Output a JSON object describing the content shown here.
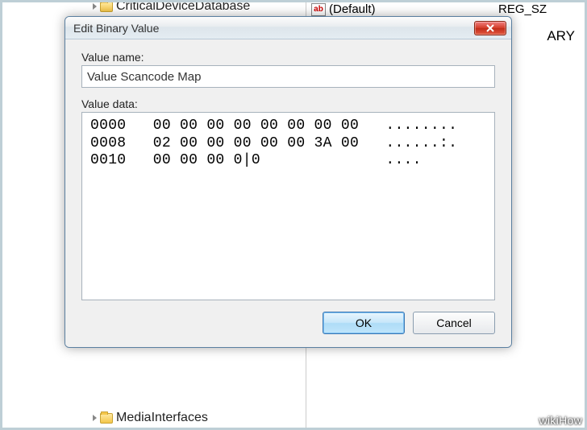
{
  "background": {
    "tree": {
      "item_top": "CriticalDeviceDatabase",
      "item_bottom": "MediaInterfaces"
    },
    "values": {
      "default_name": "(Default)",
      "default_type": "REG_SZ",
      "partial_type": "ARY"
    }
  },
  "dialog": {
    "title": "Edit Binary Value",
    "value_name_label": "Value name:",
    "value_name": "Value Scancode Map",
    "value_data_label": "Value data:",
    "hex_lines": "0000   00 00 00 00 00 00 00 00   ........\n0008   02 00 00 00 00 00 3A 00   ......:.\n0010   00 00 00 0|0              ....",
    "ok_label": "OK",
    "cancel_label": "Cancel"
  },
  "watermark": "wikiHow"
}
